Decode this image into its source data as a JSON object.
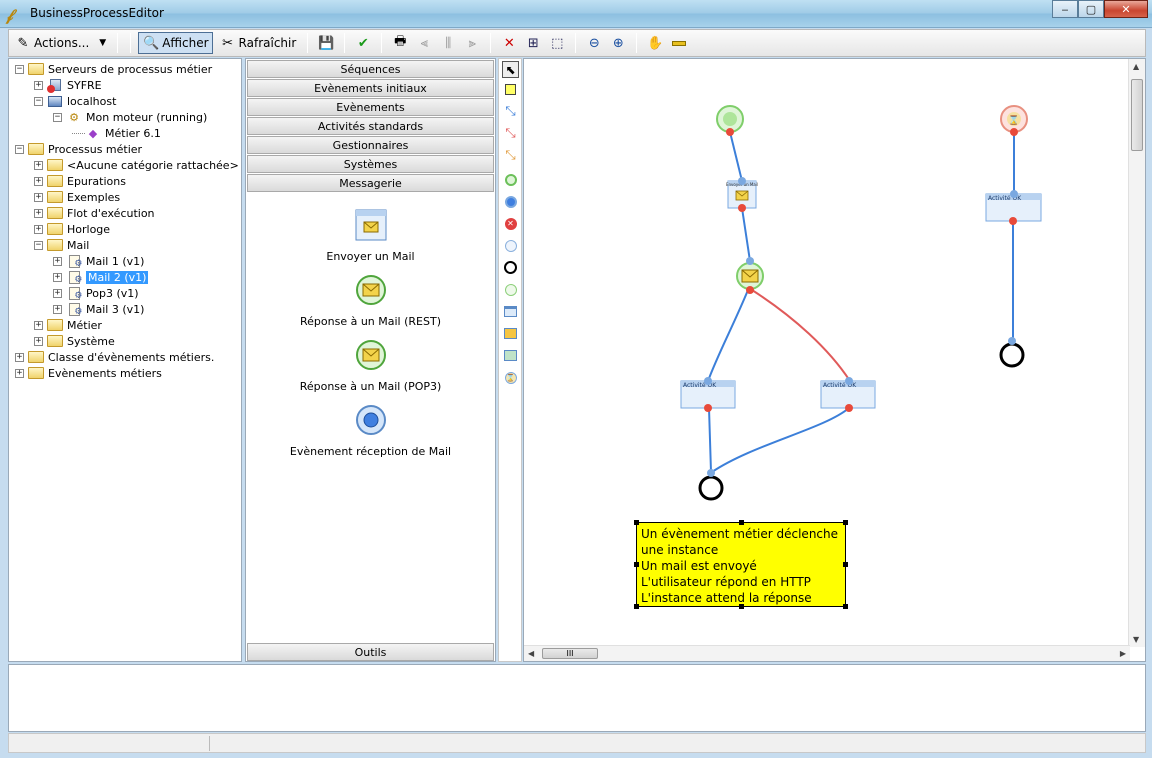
{
  "window": {
    "title": "BusinessProcessEditor",
    "minimize": "‒",
    "maximize": "▢",
    "close": "✕"
  },
  "toolbar": {
    "actions_label": "Actions...",
    "show_label": "Afficher",
    "refresh_label": "Rafraîchir"
  },
  "tree": {
    "items": [
      {
        "label": "Serveurs de processus métier",
        "level": 0,
        "expander": "−",
        "icon": "folder-icon"
      },
      {
        "label": "SYFRE",
        "level": 1,
        "expander": "+",
        "icon": "server-error-icon"
      },
      {
        "label": "localhost",
        "level": 1,
        "expander": "−",
        "icon": "server-icon"
      },
      {
        "label": "Mon moteur (running)",
        "level": 2,
        "expander": "−",
        "icon": "engine-icon"
      },
      {
        "label": "Métier 6.1",
        "level": 3,
        "expander": "",
        "icon": "diamond-icon"
      },
      {
        "label": "Processus métier",
        "level": 0,
        "expander": "−",
        "icon": "folder-icon"
      },
      {
        "label": "<Aucune catégorie rattachée>",
        "level": 1,
        "expander": "+",
        "icon": "folder-icon"
      },
      {
        "label": "Epurations",
        "level": 1,
        "expander": "+",
        "icon": "folder-icon"
      },
      {
        "label": "Exemples",
        "level": 1,
        "expander": "+",
        "icon": "folder-icon"
      },
      {
        "label": "Flot d'exécution",
        "level": 1,
        "expander": "+",
        "icon": "folder-icon"
      },
      {
        "label": "Horloge",
        "level": 1,
        "expander": "+",
        "icon": "folder-icon"
      },
      {
        "label": "Mail",
        "level": 1,
        "expander": "−",
        "icon": "folder-icon"
      },
      {
        "label": "Mail 1 (v1)",
        "level": 2,
        "expander": "+",
        "icon": "process-icon"
      },
      {
        "label": "Mail 2 (v1)",
        "level": 2,
        "expander": "+",
        "icon": "process-icon",
        "selected": true
      },
      {
        "label": "Pop3 (v1)",
        "level": 2,
        "expander": "+",
        "icon": "process-icon"
      },
      {
        "label": "Mail 3 (v1)",
        "level": 2,
        "expander": "+",
        "icon": "process-icon"
      },
      {
        "label": "Métier",
        "level": 1,
        "expander": "+",
        "icon": "folder-icon"
      },
      {
        "label": "Système",
        "level": 1,
        "expander": "+",
        "icon": "folder-icon"
      },
      {
        "label": "Classe d'évènements métiers.",
        "level": 0,
        "expander": "+",
        "icon": "folder-icon"
      },
      {
        "label": "Evènements métiers",
        "level": 0,
        "expander": "+",
        "icon": "folder-icon"
      }
    ]
  },
  "palette": {
    "categories": [
      "Séquences",
      "Evènements initiaux",
      "Evènements",
      "Activités standards",
      "Gestionnaires",
      "Systèmes",
      "Messagerie"
    ],
    "items": [
      {
        "label": "Envoyer un Mail"
      },
      {
        "label": "Réponse à un Mail (REST)"
      },
      {
        "label": "Réponse à un Mail (POP3)"
      },
      {
        "label": "Evènement réception de Mail"
      }
    ],
    "footer": "Outils"
  },
  "canvas": {
    "node_label": "Activité OK",
    "send_mail_node_label": "Envoyer un Mail",
    "note_lines": [
      "Un évènement métier déclenche une instance",
      "Un mail est envoyé",
      "L'utilisateur répond en HTTP",
      "L'instance attend la réponse"
    ],
    "scroll_grip": "III"
  },
  "colors": {
    "accent": "#3399ff",
    "flow_blue": "#3c7fd9",
    "flow_red": "#e05a5a",
    "note_yellow": "#ffff00"
  }
}
